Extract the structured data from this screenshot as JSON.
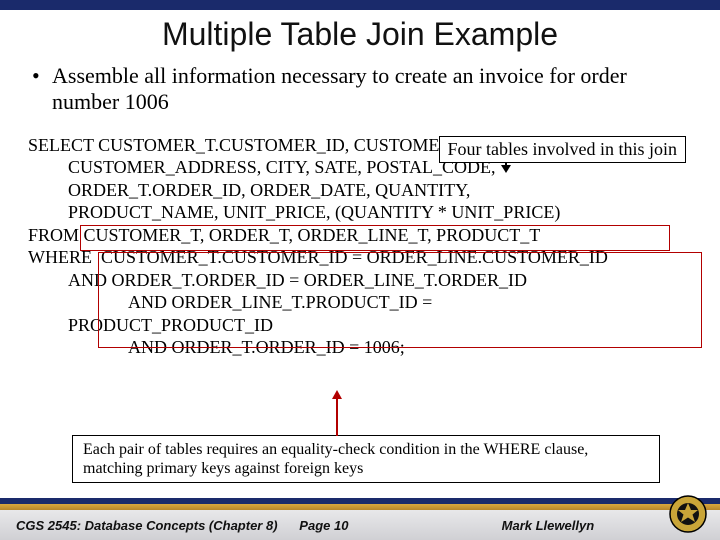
{
  "title": "Multiple Table Join Example",
  "bullet": "Assemble all information necessary to create an invoice for order number 1006",
  "annotation_top": "Four tables involved in this join",
  "sql": {
    "l0": "SELECT CUSTOMER_T.CUSTOMER_ID, CUSTOMER_NAME,",
    "l1": "CUSTOMER_ADDRESS, CITY, SATE, POSTAL_CODE,",
    "l2": "ORDER_T.ORDER_ID, ORDER_DATE, QUANTITY,",
    "l3": "PRODUCT_NAME, UNIT_PRICE, (QUANTITY * UNIT_PRICE)",
    "l4": "FROM CUSTOMER_T, ORDER_T, ORDER_LINE_T, PRODUCT_T",
    "l5": "WHERE  CUSTOMER_T.CUSTOMER_ID = ORDER_LINE.CUSTOMER_ID",
    "l6": "AND ORDER_T.ORDER_ID = ORDER_LINE_T.ORDER_ID",
    "l7": "AND ORDER_LINE_T.PRODUCT_ID =",
    "l8": "PRODUCT_PRODUCT_ID",
    "l9": "AND ORDER_T.ORDER_ID = 1006;"
  },
  "annotation_bottom": "Each pair of tables requires an equality-check condition in the WHERE clause, matching primary keys against foreign keys",
  "footer": {
    "left": "CGS 2545: Database Concepts  (Chapter 8)",
    "mid": "Page 10",
    "right": "Mark Llewellyn"
  }
}
